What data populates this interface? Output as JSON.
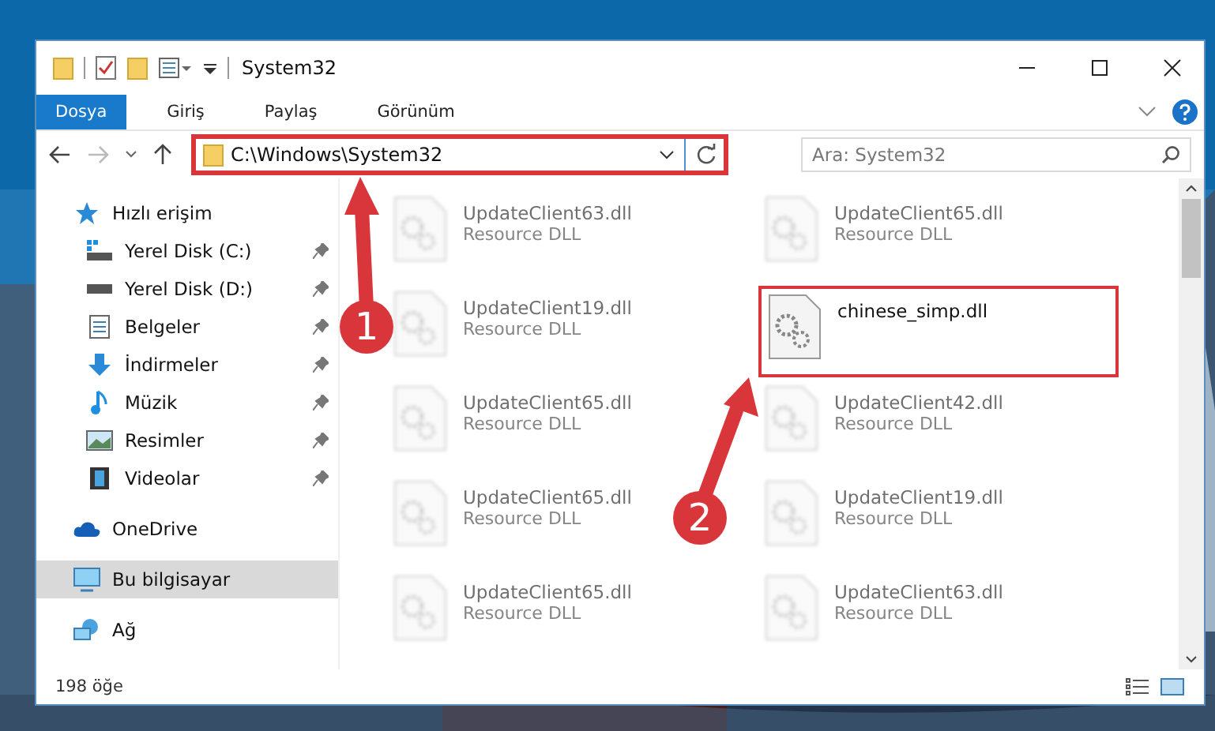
{
  "window": {
    "title": "System32"
  },
  "ribbon_tabs": [
    {
      "label": "Dosya",
      "selected": true
    },
    {
      "label": "Giriş",
      "selected": false
    },
    {
      "label": "Paylaş",
      "selected": false
    },
    {
      "label": "Görünüm",
      "selected": false
    }
  ],
  "address_bar": {
    "path": "C:\\Windows\\System32",
    "highlighted": true
  },
  "search": {
    "placeholder": "Ara: System32"
  },
  "sidebar": {
    "items": [
      {
        "label": "Hızlı erişim",
        "kind": "star",
        "selected": false,
        "children": [
          {
            "label": "Yerel Disk (C:)",
            "kind": "windrive",
            "pinned": true,
            "selected": false
          },
          {
            "label": "Yerel Disk (D:)",
            "kind": "drive",
            "pinned": true,
            "selected": false
          },
          {
            "label": "Belgeler",
            "kind": "documents",
            "pinned": true,
            "selected": false
          },
          {
            "label": "İndirmeler",
            "kind": "download",
            "pinned": true,
            "selected": false
          },
          {
            "label": "Müzik",
            "kind": "music",
            "pinned": true,
            "selected": false
          },
          {
            "label": "Resimler",
            "kind": "pictures",
            "pinned": true,
            "selected": false
          },
          {
            "label": "Videolar",
            "kind": "videos",
            "pinned": true,
            "selected": false
          }
        ]
      },
      {
        "label": "OneDrive",
        "kind": "cloud",
        "selected": false
      },
      {
        "label": "Bu bilgisayar",
        "kind": "computer",
        "selected": true
      },
      {
        "label": "Ağ",
        "kind": "network",
        "selected": false
      }
    ]
  },
  "files": [
    {
      "name": "UpdateClient63.dll",
      "type": "Resource DLL",
      "blurred": true
    },
    {
      "name": "UpdateClient65.dll",
      "type": "Resource DLL",
      "blurred": true
    },
    {
      "name": "UpdateClient19.dll",
      "type": "Resource DLL",
      "blurred": true
    },
    {
      "name": "chinese_simp.dll",
      "blurred": false,
      "highlighted": true
    },
    {
      "name": "UpdateClient65.dll",
      "type": "Resource DLL",
      "blurred": true
    },
    {
      "name": "UpdateClient42.dll",
      "type": "Resource DLL",
      "blurred": true
    },
    {
      "name": "UpdateClient65.dll",
      "type": "Resource DLL",
      "blurred": true
    },
    {
      "name": "UpdateClient19.dll",
      "type": "Resource DLL",
      "blurred": true
    },
    {
      "name": "UpdateClient65.dll",
      "type": "Resource DLL",
      "blurred": true
    },
    {
      "name": "UpdateClient63.dll",
      "type": "Resource DLL",
      "blurred": true
    }
  ],
  "status_bar": {
    "count": "198 öğe"
  },
  "annotations": [
    {
      "number": "1"
    },
    {
      "number": "2"
    }
  ]
}
